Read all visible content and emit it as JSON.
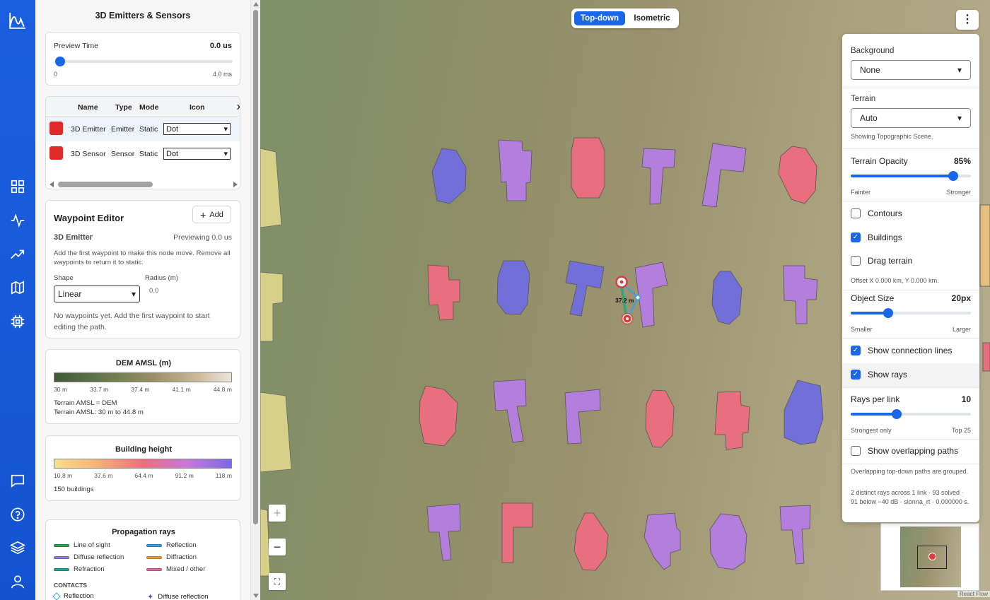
{
  "panel": {
    "title": "3D Emitters & Sensors",
    "preview": {
      "label": "Preview Time",
      "value": "0.0 us",
      "min": "0",
      "max": "4.0 ms",
      "fraction": 0
    },
    "table": {
      "columns": [
        "Name",
        "Type",
        "Mode",
        "Icon",
        "X"
      ],
      "rows": [
        {
          "name": "3D Emitter",
          "type": "Emitter",
          "mode": "Static",
          "icon": "Dot",
          "color": "#e02a2a"
        },
        {
          "name": "3D Sensor",
          "type": "Sensor",
          "mode": "Static",
          "icon": "Dot",
          "color": "#e02a2a"
        }
      ]
    },
    "waypoint": {
      "title": "Waypoint Editor",
      "add_label": "Add",
      "node": "3D Emitter",
      "previewing": "Previewing 0.0 us",
      "desc": "Add the first waypoint to make this node move. Remove all waypoints to return it to static.",
      "shape_label": "Shape",
      "shape_value": "Linear",
      "radius_label": "Radius (m)",
      "radius_value": "0.0",
      "empty": "No waypoints yet. Add the first waypoint to start editing the path."
    },
    "dem": {
      "title": "DEM AMSL (m)",
      "ticks": [
        "30 m",
        "33.7 m",
        "37.4 m",
        "41.1 m",
        "44.8 m"
      ],
      "line1": "Terrain AMSL = DEM",
      "line2": "Terrain AMSL: 30 m to 44.8 m"
    },
    "building": {
      "title": "Building height",
      "ticks": [
        "10.8 m",
        "37.6 m",
        "64.4 m",
        "91.2 m",
        "118 m"
      ],
      "count": "150 buildings"
    },
    "rays": {
      "title": "Propagation rays",
      "legend": [
        {
          "label": "Line of sight",
          "color": "#2aa84a"
        },
        {
          "label": "Reflection",
          "color": "#3aa0e0"
        },
        {
          "label": "Diffuse reflection",
          "color": "#9a7ee8"
        },
        {
          "label": "Diffraction",
          "color": "#e8a23a"
        },
        {
          "label": "Refraction",
          "color": "#24a894"
        },
        {
          "label": "Mixed / other",
          "color": "#e06aa8"
        }
      ],
      "contacts_title": "CONTACTS",
      "contacts": [
        "Reflection",
        "Diffuse reflection"
      ]
    }
  },
  "map": {
    "view_options": [
      "Top-down",
      "Isometric"
    ],
    "active_view": "Top-down",
    "link_label": "37.2 m",
    "attribution": "React Flow"
  },
  "settings": {
    "background_label": "Background",
    "background_value": "None",
    "terrain_label": "Terrain",
    "terrain_value": "Auto",
    "terrain_note": "Showing Topographic Scene.",
    "opacity_label": "Terrain Opacity",
    "opacity_value": "85%",
    "opacity_fraction": 0.85,
    "opacity_min": "Fainter",
    "opacity_max": "Stronger",
    "contours": "Contours",
    "buildings": "Buildings",
    "drag": "Drag terrain",
    "offset": "Offset X 0.000 km, Y 0.000 km.",
    "object_size_label": "Object Size",
    "object_size_value": "20px",
    "object_size_fraction": 0.31,
    "object_size_min": "Smaller",
    "object_size_max": "Larger",
    "show_lines": "Show connection lines",
    "show_rays": "Show rays",
    "rays_label": "Rays per link",
    "rays_value": "10",
    "rays_fraction": 0.38,
    "rays_min": "Strongest only",
    "rays_max": "Top 25",
    "overlap": "Show overlapping paths",
    "overlap_note": "Overlapping top-down paths are grouped.",
    "stats": "2 distinct rays across 1 link · 93 solved · 91 below −40 dB · sionna_rt · 0.000000 s."
  }
}
